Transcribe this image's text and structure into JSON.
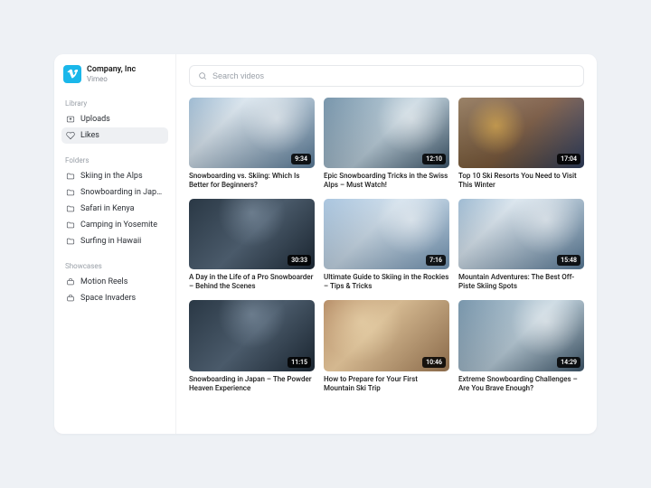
{
  "brand": {
    "title": "Company, Inc",
    "subtitle": "Vimeo"
  },
  "search": {
    "placeholder": "Search videos"
  },
  "sections": {
    "library": {
      "label": "Library",
      "items": [
        {
          "label": "Uploads",
          "icon": "upload",
          "active": false
        },
        {
          "label": "Likes",
          "icon": "heart",
          "active": true
        }
      ]
    },
    "folders": {
      "label": "Folders",
      "items": [
        {
          "label": "Skiing in the Alps"
        },
        {
          "label": "Snowboarding in Japan"
        },
        {
          "label": "Safari in Kenya"
        },
        {
          "label": "Camping in Yosemite"
        },
        {
          "label": "Surfing in Hawaii"
        }
      ]
    },
    "showcases": {
      "label": "Showcases",
      "items": [
        {
          "label": "Motion Reels"
        },
        {
          "label": "Space Invaders"
        }
      ]
    }
  },
  "videos": [
    {
      "title": "Snowboarding vs. Skiing: Which Is Better for Beginners?",
      "duration": "9:34",
      "style": "action"
    },
    {
      "title": "Epic Snowboarding Tricks in the Swiss Alps – Must Watch!",
      "duration": "12:10",
      "style": "steep"
    },
    {
      "title": "Top 10 Ski Resorts You Need to Visit This Winter",
      "duration": "17:04",
      "style": "village"
    },
    {
      "title": "A Day in the Life of a Pro Snowboarder – Behind the Scenes",
      "duration": "30:33",
      "style": "dark"
    },
    {
      "title": "Ultimate Guide to Skiing in the Rockies – Tips & Tricks",
      "duration": "7:16",
      "style": ""
    },
    {
      "title": "Mountain Adventures: The Best Off-Piste Skiing Spots",
      "duration": "15:48",
      "style": "action"
    },
    {
      "title": "Snowboarding in Japan – The Powder Heaven Experience",
      "duration": "11:15",
      "style": "dark"
    },
    {
      "title": "How to Prepare for Your First Mountain Ski Trip",
      "duration": "10:46",
      "style": "indoor"
    },
    {
      "title": "Extreme Snowboarding Challenges – Are You Brave Enough?",
      "duration": "14:29",
      "style": "steep"
    }
  ]
}
